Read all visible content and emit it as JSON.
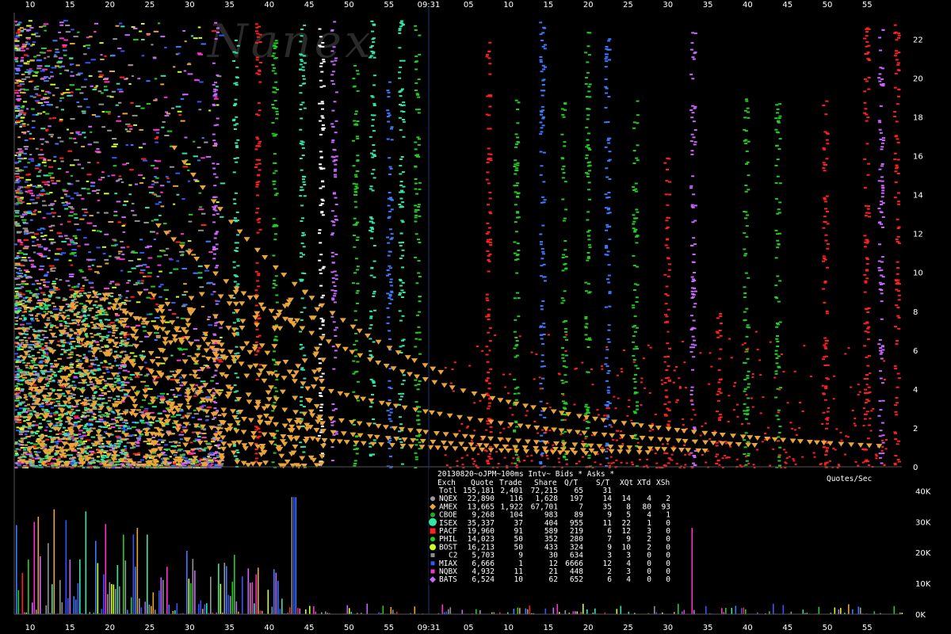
{
  "chart_data": [
    {
      "type": "scatter",
      "watermark": "Nanex",
      "x_ticks_top": [
        "10",
        "15",
        "20",
        "25",
        "30",
        "35",
        "40",
        "45",
        "50",
        "55",
        "09:31",
        "05",
        "10",
        "15",
        "20",
        "25",
        "30",
        "35",
        "40",
        "45",
        "50",
        "55"
      ],
      "x_ticks_bottom": [
        "10",
        "15",
        "20",
        "25",
        "30",
        "35",
        "40",
        "45",
        "50",
        "55",
        "09:31",
        "05",
        "10",
        "15",
        "20",
        "25",
        "30",
        "35",
        "40",
        "45",
        "50",
        "55"
      ],
      "y_ticks": [
        "0",
        "2",
        "4",
        "6",
        "8",
        "10",
        "12",
        "14",
        "16",
        "18",
        "20",
        "22"
      ],
      "ylim": [
        0,
        23.2
      ],
      "series": [
        {
          "name": "NQEX",
          "color": "#9a9a9a"
        },
        {
          "name": "AMEX",
          "color": "#e8a53a"
        },
        {
          "name": "CBOE",
          "color": "#3a7bff"
        },
        {
          "name": "ISEX",
          "color": "#33e6a6"
        },
        {
          "name": "PACF",
          "color": "#ff2020"
        },
        {
          "name": "PHIL",
          "color": "#22cc22"
        },
        {
          "name": "BOST",
          "color": "#ccff22"
        },
        {
          "name": "C2",
          "color": "#909090"
        },
        {
          "name": "MIAX",
          "color": "#3355ff"
        },
        {
          "name": "NQBX",
          "color": "#ff33cc"
        },
        {
          "name": "BATS",
          "color": "#cc66ff"
        }
      ]
    },
    {
      "type": "bar",
      "y_ticks": [
        "0K",
        "10K",
        "20K",
        "30K",
        "40K"
      ],
      "ylim": [
        0,
        45000
      ],
      "ylabel": "Quotes/Sec",
      "x_ticks": [
        "10",
        "15",
        "20",
        "25",
        "30",
        "35",
        "40",
        "45",
        "50",
        "55",
        "09:31",
        "05",
        "10",
        "15",
        "20",
        "25",
        "30",
        "35",
        "40",
        "45",
        "50",
        "55"
      ]
    }
  ],
  "legend": {
    "title": "20130820~oJPM~100ms Intv~ Bids * Asks *",
    "quotes_per_sec": "Quotes/Sec",
    "header": [
      "Exch",
      "Quote",
      "Trade",
      "Share",
      "Q/T",
      "S/T",
      "XQt",
      "XTd",
      "XSh"
    ],
    "rows": [
      {
        "exch": "Totl",
        "quote": "155,181",
        "trade": "2,401",
        "share": "72,215",
        "qt": "65",
        "st": "31",
        "xqt": "",
        "xtd": "",
        "xsh": "",
        "color": "",
        "shape": "none"
      },
      {
        "exch": "NQEX",
        "quote": "22,890",
        "trade": "116",
        "share": "1,628",
        "qt": "197",
        "st": "14",
        "xqt": "14",
        "xtd": "4",
        "xsh": "2",
        "color": "#9a9a9a",
        "shape": "circle"
      },
      {
        "exch": "AMEX",
        "quote": "13,665",
        "trade": "1,922",
        "share": "67,701",
        "qt": "7",
        "st": "35",
        "xqt": "8",
        "xtd": "80",
        "xsh": "93",
        "color": "#e8a53a",
        "shape": "diamond"
      },
      {
        "exch": "CBOE",
        "quote": "9,268",
        "trade": "104",
        "share": "983",
        "qt": "89",
        "st": "9",
        "xqt": "5",
        "xtd": "4",
        "xsh": "1",
        "color": "#22aa22",
        "shape": "circle"
      },
      {
        "exch": "ISEX",
        "quote": "35,337",
        "trade": "37",
        "share": "404",
        "qt": "955",
        "st": "11",
        "xqt": "22",
        "xtd": "1",
        "xsh": "0",
        "color": "#33e6a6",
        "shape": "bigcircle"
      },
      {
        "exch": "PACF",
        "quote": "19,960",
        "trade": "91",
        "share": "589",
        "qt": "219",
        "st": "6",
        "xqt": "12",
        "xtd": "3",
        "xsh": "0",
        "color": "#ff2020",
        "shape": "square"
      },
      {
        "exch": "PHIL",
        "quote": "14,023",
        "trade": "50",
        "share": "352",
        "qt": "280",
        "st": "7",
        "xqt": "9",
        "xtd": "2",
        "xsh": "0",
        "color": "#22cc22",
        "shape": "circle"
      },
      {
        "exch": "BOST",
        "quote": "16,213",
        "trade": "50",
        "share": "433",
        "qt": "324",
        "st": "9",
        "xqt": "10",
        "xtd": "2",
        "xsh": "0",
        "color": "#ccff22",
        "shape": "hex"
      },
      {
        "exch": "C2",
        "quote": "5,703",
        "trade": "9",
        "share": "30",
        "qt": "634",
        "st": "3",
        "xqt": "3",
        "xtd": "0",
        "xsh": "0",
        "color": "#909090",
        "shape": "smallsquare"
      },
      {
        "exch": "MIAX",
        "quote": "6,666",
        "trade": "1",
        "share": "12",
        "qt": "6666",
        "st": "12",
        "xqt": "4",
        "xtd": "0",
        "xsh": "0",
        "color": "#3355ff",
        "shape": "smallsquare"
      },
      {
        "exch": "NQBX",
        "quote": "4,932",
        "trade": "11",
        "share": "21",
        "qt": "448",
        "st": "2",
        "xqt": "3",
        "xtd": "0",
        "xsh": "0",
        "color": "#ff33cc",
        "shape": "smallsquare"
      },
      {
        "exch": "BATS",
        "quote": "6,524",
        "trade": "10",
        "share": "62",
        "qt": "652",
        "st": "6",
        "xqt": "4",
        "xtd": "0",
        "xsh": "0",
        "color": "#cc66ff",
        "shape": "diamond"
      }
    ]
  }
}
